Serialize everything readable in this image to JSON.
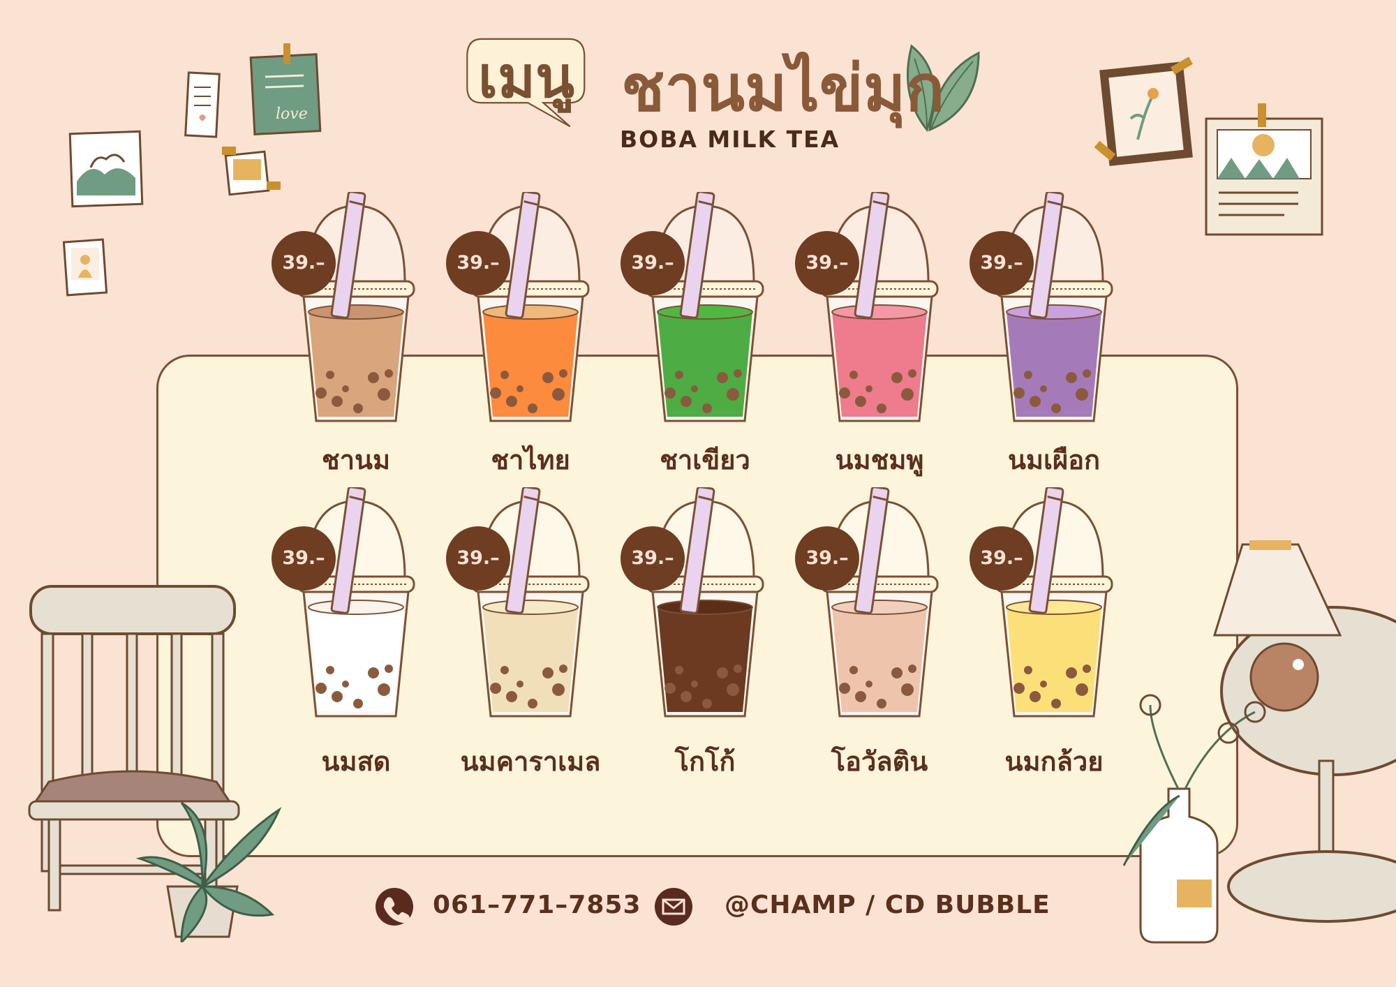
{
  "header": {
    "bubble_text": "เมนู",
    "title": "ชานมไข่มุก",
    "subtitle": "BOBA MILK TEA"
  },
  "menu": {
    "items": [
      {
        "name": "ชานม",
        "price": "39.–",
        "tea_color": "#d9a57c",
        "top_color": "#c99472"
      },
      {
        "name": "ชาไทย",
        "price": "39.–",
        "tea_color": "#fc8b3e",
        "top_color": "#f0b87a"
      },
      {
        "name": "ชาเขียว",
        "price": "39.–",
        "tea_color": "#4eac44",
        "top_color": "#4fb843"
      },
      {
        "name": "นมชมพู",
        "price": "39.–",
        "tea_color": "#ee7c8c",
        "top_color": "#f597a4"
      },
      {
        "name": "นมเผือก",
        "price": "39.–",
        "tea_color": "#a47bb8",
        "top_color": "#c9a0e0"
      },
      {
        "name": "นมสด",
        "price": "39.–",
        "tea_color": "#ffffff",
        "top_color": "#fbf4ec"
      },
      {
        "name": "นมคาราเมล",
        "price": "39.–",
        "tea_color": "#f0dfb8",
        "top_color": "#f6e9c8"
      },
      {
        "name": "โกโก้",
        "price": "39.–",
        "tea_color": "#6b3a20",
        "top_color": "#5c2e18"
      },
      {
        "name": "โอวัลติน",
        "price": "39.–",
        "tea_color": "#efc4ad",
        "top_color": "#f0d0bc"
      },
      {
        "name": "นมกล้วย",
        "price": "39.–",
        "tea_color": "#fbe07a",
        "top_color": "#fde893"
      }
    ]
  },
  "contact": {
    "phone": "061–771–7853",
    "line_id": "@CHAMP / CD BUBBLE",
    "phone_icon": "phone-icon",
    "message_icon": "envelope-icon"
  },
  "colors": {
    "background": "#fbe3d4",
    "panel": "#fdf4dc",
    "outline": "#7b5035",
    "price_badge": "#6e3d22",
    "boba": "#8b5a3e"
  }
}
